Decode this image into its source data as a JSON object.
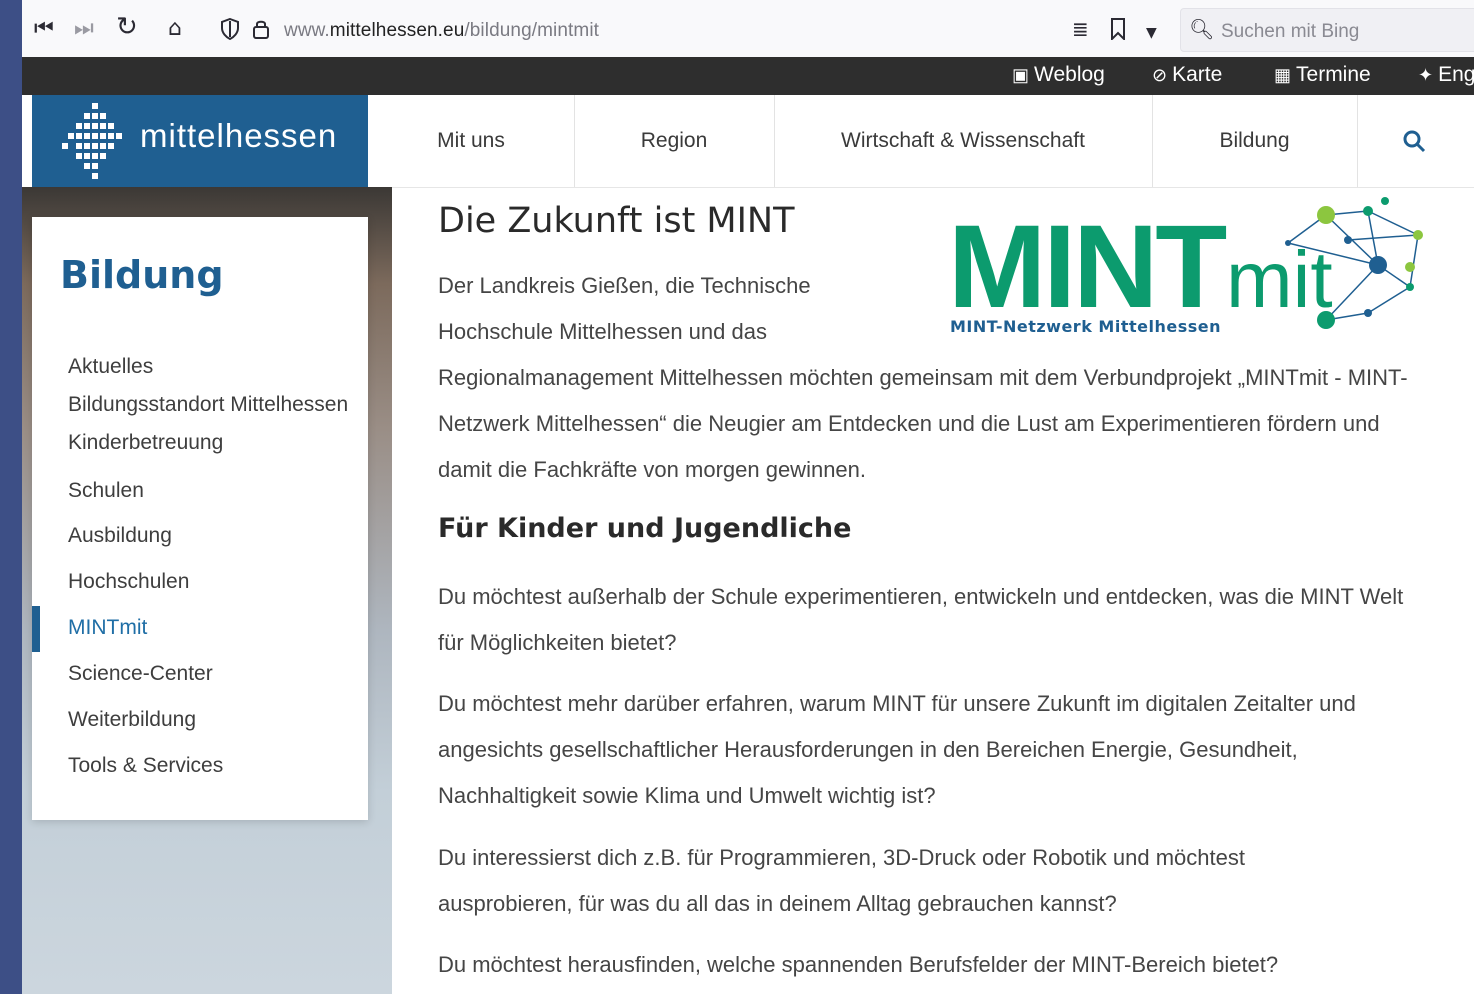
{
  "browser": {
    "url_prefix": "www.",
    "url_domain": "mittelhessen.eu",
    "url_path": "/bildung/mintmit",
    "search_placeholder": "Suchen mit Bing"
  },
  "service_bar": {
    "items": [
      {
        "label": "Weblog",
        "icon": "rss-icon"
      },
      {
        "label": "Karte",
        "icon": "compass-icon"
      },
      {
        "label": "Termine",
        "icon": "calendar-icon"
      },
      {
        "label": "Eng",
        "icon": "pin-icon"
      }
    ]
  },
  "site": {
    "logo_text": "mittelhessen",
    "logo_color": "#1f5f91"
  },
  "nav": {
    "items": [
      "Mit uns",
      "Region",
      "Wirtschaft & Wissenschaft",
      "Bildung"
    ],
    "search_icon": "search-icon"
  },
  "sidebar": {
    "title": "Bildung",
    "items": [
      {
        "label": "Aktuelles"
      },
      {
        "label": "Bildungsstandort Mittelhessen"
      },
      {
        "label": "Kinderbetreuung"
      },
      {
        "label": "Schulen"
      },
      {
        "label": "Ausbildung"
      },
      {
        "label": "Hochschulen"
      },
      {
        "label": "MINTmit",
        "active": true
      },
      {
        "label": "Science-Center"
      },
      {
        "label": "Weiterbildung"
      },
      {
        "label": "Tools & Services"
      }
    ]
  },
  "content": {
    "title": "Die Zukunft ist MINT",
    "intro_part1": "Der Landkreis Gießen, die Technische Hochschule Mittelhessen und das",
    "intro_part2": "Regionalmanagement Mittelhessen möchten gemeinsam mit dem Verbundprojekt „MINTmit - MINT-Netzwerk Mittelhessen“ die Neugier am Entdecken und die Lust am Experimentieren fördern und damit die Fachkräfte von morgen gewinnen.",
    "subheading": "Für Kinder und Jugendliche",
    "paragraphs": [
      "Du möchtest außerhalb der Schule experimentieren, entwickeln und entdecken, was die MINT Welt für Möglichkeiten bietet?",
      "Du möchtest mehr darüber erfahren, warum MINT für unsere Zukunft im digitalen Zeitalter und angesichts gesellschaftlicher Herausforderungen in den Bereichen Energie, Gesundheit, Nachhaltigkeit sowie Klima und Umwelt wichtig ist?",
      "Du interessierst dich z.B. für Programmieren, 3D-Druck oder Robotik und möchtest ausprobieren, für was du all das in deinem Alltag gebrauchen kannst?",
      "Du möchtest herausfinden, welche spannenden Berufsfelder der MINT-Bereich bietet?"
    ],
    "mint_logo": {
      "word": "MINT",
      "suffix": "mit",
      "tagline": "MINT-Netzwerk Mittelhessen",
      "green": "#0c9b6e",
      "blue": "#1f5f91"
    }
  }
}
